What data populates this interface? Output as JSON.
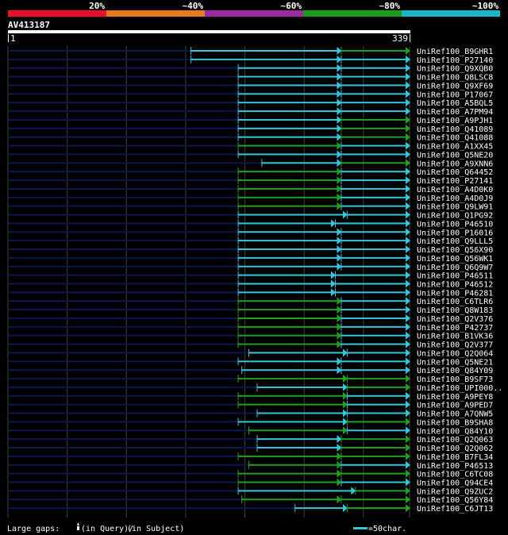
{
  "query": {
    "id": "AV413187",
    "start": "1",
    "end": "339",
    "length": 339
  },
  "score_scale": {
    "labels": [
      "20%",
      "~40%",
      "~60%",
      "~80%",
      "~100%"
    ],
    "colors": [
      "#e8112a",
      "#e87a1e",
      "#9a2aa0",
      "#1a9e1a",
      "#16b8c8"
    ]
  },
  "colors": {
    "cyan": "#35c5dc",
    "green": "#1fa01f",
    "navy": "#0a1552",
    "grid": "#36472c",
    "white": "#ffffff"
  },
  "hits": [
    {
      "name": "UniRef100_B9GHR1",
      "segs": [
        [
          0,
          "n"
        ],
        [
          154,
          "c"
        ],
        [
          281,
          "g"
        ],
        [
          339,
          "e"
        ]
      ]
    },
    {
      "name": "UniRef100_P27140",
      "segs": [
        [
          0,
          "n"
        ],
        [
          154,
          "c"
        ],
        [
          281,
          "c"
        ],
        [
          339,
          "e"
        ]
      ]
    },
    {
      "name": "UniRef100_Q9XQB0",
      "segs": [
        [
          0,
          "n"
        ],
        [
          194,
          "c"
        ],
        [
          281,
          "c"
        ],
        [
          339,
          "e"
        ]
      ]
    },
    {
      "name": "UniRef100_Q8LSC8",
      "segs": [
        [
          0,
          "n"
        ],
        [
          194,
          "c"
        ],
        [
          281,
          "c"
        ],
        [
          339,
          "e"
        ]
      ]
    },
    {
      "name": "UniRef100_Q9XF69",
      "segs": [
        [
          0,
          "n"
        ],
        [
          194,
          "c"
        ],
        [
          281,
          "c"
        ],
        [
          339,
          "e"
        ]
      ]
    },
    {
      "name": "UniRef100_P17067",
      "segs": [
        [
          0,
          "n"
        ],
        [
          194,
          "c"
        ],
        [
          281,
          "c"
        ],
        [
          339,
          "e"
        ]
      ]
    },
    {
      "name": "UniRef100_A5BQL5",
      "segs": [
        [
          0,
          "n"
        ],
        [
          194,
          "c"
        ],
        [
          281,
          "c"
        ],
        [
          339,
          "e"
        ]
      ]
    },
    {
      "name": "UniRef100_A7PM94",
      "segs": [
        [
          0,
          "n"
        ],
        [
          194,
          "c"
        ],
        [
          281,
          "c"
        ],
        [
          339,
          "e"
        ]
      ]
    },
    {
      "name": "UniRef100_A9PJH1",
      "segs": [
        [
          0,
          "n"
        ],
        [
          194,
          "c"
        ],
        [
          281,
          "g"
        ],
        [
          339,
          "e"
        ]
      ]
    },
    {
      "name": "UniRef100_Q41089",
      "segs": [
        [
          0,
          "n"
        ],
        [
          194,
          "c"
        ],
        [
          281,
          "g"
        ],
        [
          339,
          "e"
        ]
      ]
    },
    {
      "name": "UniRef100_Q41088",
      "segs": [
        [
          0,
          "n"
        ],
        [
          194,
          "c"
        ],
        [
          281,
          "g"
        ],
        [
          339,
          "e"
        ]
      ]
    },
    {
      "name": "UniRef100_A1XX45",
      "segs": [
        [
          0,
          "n"
        ],
        [
          194,
          "g"
        ],
        [
          281,
          "c"
        ],
        [
          339,
          "e"
        ]
      ]
    },
    {
      "name": "UniRef100_Q5NE20",
      "segs": [
        [
          0,
          "n"
        ],
        [
          194,
          "c"
        ],
        [
          281,
          "c"
        ],
        [
          339,
          "e"
        ]
      ]
    },
    {
      "name": "UniRef100_A9XNN6",
      "segs": [
        [
          0,
          "n"
        ],
        [
          214,
          "c"
        ],
        [
          281,
          "g"
        ],
        [
          339,
          "e"
        ]
      ]
    },
    {
      "name": "UniRef100_Q64452",
      "segs": [
        [
          0,
          "n"
        ],
        [
          194,
          "g"
        ],
        [
          281,
          "c"
        ],
        [
          339,
          "e"
        ]
      ]
    },
    {
      "name": "UniRef100_P27141",
      "segs": [
        [
          0,
          "n"
        ],
        [
          194,
          "g"
        ],
        [
          281,
          "c"
        ],
        [
          339,
          "e"
        ]
      ]
    },
    {
      "name": "UniRef100_A4D0K0",
      "segs": [
        [
          0,
          "n"
        ],
        [
          194,
          "g"
        ],
        [
          281,
          "c"
        ],
        [
          339,
          "e"
        ]
      ]
    },
    {
      "name": "UniRef100_A4D0J9",
      "segs": [
        [
          0,
          "n"
        ],
        [
          194,
          "g"
        ],
        [
          281,
          "c"
        ],
        [
          339,
          "e"
        ]
      ]
    },
    {
      "name": "UniRef100_Q9LW91",
      "segs": [
        [
          0,
          "n"
        ],
        [
          194,
          "g"
        ],
        [
          281,
          "c"
        ],
        [
          339,
          "e"
        ]
      ]
    },
    {
      "name": "UniRef100_Q1PG92",
      "segs": [
        [
          0,
          "n"
        ],
        [
          194,
          "c"
        ],
        [
          286,
          "c"
        ],
        [
          339,
          "e"
        ]
      ]
    },
    {
      "name": "UniRef100_P46510",
      "segs": [
        [
          0,
          "n"
        ],
        [
          194,
          "c"
        ],
        [
          276,
          "c"
        ],
        [
          339,
          "e"
        ]
      ]
    },
    {
      "name": "UniRef100_P16016",
      "segs": [
        [
          0,
          "n"
        ],
        [
          194,
          "c"
        ],
        [
          281,
          "c"
        ],
        [
          339,
          "e"
        ]
      ]
    },
    {
      "name": "UniRef100_Q9LLL5",
      "segs": [
        [
          0,
          "n"
        ],
        [
          194,
          "c"
        ],
        [
          281,
          "c"
        ],
        [
          339,
          "e"
        ]
      ]
    },
    {
      "name": "UniRef100_Q56X90",
      "segs": [
        [
          0,
          "n"
        ],
        [
          194,
          "c"
        ],
        [
          281,
          "c"
        ],
        [
          339,
          "e"
        ]
      ]
    },
    {
      "name": "UniRef100_Q56WK1",
      "segs": [
        [
          0,
          "n"
        ],
        [
          194,
          "c"
        ],
        [
          281,
          "c"
        ],
        [
          339,
          "e"
        ]
      ]
    },
    {
      "name": "UniRef100_Q6Q9W7",
      "segs": [
        [
          0,
          "n"
        ],
        [
          194,
          "c"
        ],
        [
          281,
          "c"
        ],
        [
          339,
          "e"
        ]
      ]
    },
    {
      "name": "UniRef100_P46511",
      "segs": [
        [
          0,
          "n"
        ],
        [
          194,
          "c"
        ],
        [
          276,
          "c"
        ],
        [
          339,
          "e"
        ]
      ]
    },
    {
      "name": "UniRef100_P46512",
      "segs": [
        [
          0,
          "n"
        ],
        [
          194,
          "c"
        ],
        [
          276,
          "c"
        ],
        [
          339,
          "e"
        ]
      ]
    },
    {
      "name": "UniRef100_P46281",
      "segs": [
        [
          0,
          "n"
        ],
        [
          194,
          "c"
        ],
        [
          276,
          "c"
        ],
        [
          339,
          "e"
        ]
      ]
    },
    {
      "name": "UniRef100_C6TLR6",
      "segs": [
        [
          0,
          "n"
        ],
        [
          194,
          "g"
        ],
        [
          281,
          "c"
        ],
        [
          339,
          "e"
        ]
      ]
    },
    {
      "name": "UniRef100_Q8W183",
      "segs": [
        [
          0,
          "n"
        ],
        [
          194,
          "g"
        ],
        [
          281,
          "c"
        ],
        [
          339,
          "e"
        ]
      ]
    },
    {
      "name": "UniRef100_Q2V376",
      "segs": [
        [
          0,
          "n"
        ],
        [
          194,
          "g"
        ],
        [
          281,
          "c"
        ],
        [
          339,
          "e"
        ]
      ]
    },
    {
      "name": "UniRef100_P42737",
      "segs": [
        [
          0,
          "n"
        ],
        [
          194,
          "g"
        ],
        [
          281,
          "c"
        ],
        [
          339,
          "e"
        ]
      ]
    },
    {
      "name": "UniRef100_B1VK36",
      "segs": [
        [
          0,
          "n"
        ],
        [
          194,
          "g"
        ],
        [
          281,
          "c"
        ],
        [
          339,
          "e"
        ]
      ]
    },
    {
      "name": "UniRef100_Q2V377",
      "segs": [
        [
          0,
          "n"
        ],
        [
          194,
          "g"
        ],
        [
          281,
          "c"
        ],
        [
          339,
          "e"
        ]
      ]
    },
    {
      "name": "UniRef100_Q2Q064",
      "segs": [
        [
          0,
          "n"
        ],
        [
          203,
          "c"
        ],
        [
          286,
          "c"
        ],
        [
          339,
          "e"
        ]
      ]
    },
    {
      "name": "UniRef100_Q5NE21",
      "segs": [
        [
          0,
          "n"
        ],
        [
          194,
          "c"
        ],
        [
          281,
          "c"
        ],
        [
          339,
          "e"
        ]
      ]
    },
    {
      "name": "UniRef100_Q84Y09",
      "segs": [
        [
          0,
          "n"
        ],
        [
          197,
          "c"
        ],
        [
          281,
          "c"
        ],
        [
          339,
          "e"
        ]
      ]
    },
    {
      "name": "UniRef100_B9SF73",
      "segs": [
        [
          0,
          "n"
        ],
        [
          194,
          "g"
        ],
        [
          286,
          "g"
        ],
        [
          339,
          "e"
        ]
      ]
    },
    {
      "name": "UniRef100_UPI000..",
      "segs": [
        [
          0,
          "n"
        ],
        [
          210,
          "c"
        ],
        [
          286,
          "g"
        ],
        [
          339,
          "e"
        ]
      ]
    },
    {
      "name": "UniRef100_A9PEY8",
      "segs": [
        [
          0,
          "n"
        ],
        [
          194,
          "g"
        ],
        [
          286,
          "c"
        ],
        [
          339,
          "e"
        ]
      ]
    },
    {
      "name": "UniRef100_A9PED7",
      "segs": [
        [
          0,
          "n"
        ],
        [
          194,
          "g"
        ],
        [
          286,
          "c"
        ],
        [
          339,
          "e"
        ]
      ]
    },
    {
      "name": "UniRef100_A7QNW5",
      "segs": [
        [
          0,
          "n"
        ],
        [
          210,
          "c"
        ],
        [
          286,
          "c"
        ],
        [
          339,
          "e"
        ]
      ]
    },
    {
      "name": "UniRef100_B9SHA8",
      "segs": [
        [
          0,
          "n"
        ],
        [
          194,
          "c"
        ],
        [
          286,
          "g"
        ],
        [
          339,
          "e"
        ]
      ]
    },
    {
      "name": "UniRef100_Q84Y10",
      "segs": [
        [
          0,
          "n"
        ],
        [
          203,
          "g"
        ],
        [
          286,
          "c"
        ],
        [
          339,
          "e"
        ]
      ]
    },
    {
      "name": "UniRef100_Q2Q063",
      "segs": [
        [
          0,
          "n"
        ],
        [
          210,
          "c"
        ],
        [
          281,
          "g"
        ],
        [
          339,
          "e"
        ]
      ]
    },
    {
      "name": "UniRef100_Q2Q062",
      "segs": [
        [
          0,
          "n"
        ],
        [
          210,
          "c"
        ],
        [
          281,
          "g"
        ],
        [
          339,
          "e"
        ]
      ]
    },
    {
      "name": "UniRef100_B7FL34",
      "segs": [
        [
          0,
          "n"
        ],
        [
          194,
          "g"
        ],
        [
          281,
          "g"
        ],
        [
          339,
          "e"
        ]
      ]
    },
    {
      "name": "UniRef100_P46513",
      "segs": [
        [
          0,
          "n"
        ],
        [
          203,
          "g"
        ],
        [
          281,
          "c"
        ],
        [
          339,
          "e"
        ]
      ]
    },
    {
      "name": "UniRef100_C6TC08",
      "segs": [
        [
          0,
          "n"
        ],
        [
          194,
          "g"
        ],
        [
          281,
          "g"
        ],
        [
          339,
          "e"
        ]
      ]
    },
    {
      "name": "UniRef100_Q94CE4",
      "segs": [
        [
          0,
          "n"
        ],
        [
          194,
          "g"
        ],
        [
          281,
          "c"
        ],
        [
          339,
          "e"
        ]
      ]
    },
    {
      "name": "UniRef100_Q9ZUC2",
      "segs": [
        [
          0,
          "n"
        ],
        [
          194,
          "c"
        ],
        [
          293,
          "g"
        ],
        [
          339,
          "e"
        ]
      ]
    },
    {
      "name": "UniRef100_Q56Y84",
      "segs": [
        [
          0,
          "n"
        ],
        [
          197,
          "g"
        ],
        [
          281,
          "g"
        ],
        [
          339,
          "e"
        ]
      ]
    },
    {
      "name": "UniRef100_C6JT13",
      "segs": [
        [
          0,
          "n"
        ],
        [
          242,
          "c"
        ],
        [
          286,
          "g"
        ],
        [
          339,
          "e"
        ]
      ]
    }
  ],
  "footer": {
    "gaps_prefix": "Large gaps:",
    "gaps_query": "(in Query)/",
    "gaps_subject": "(in Subject)",
    "legend_text": "=50char."
  }
}
